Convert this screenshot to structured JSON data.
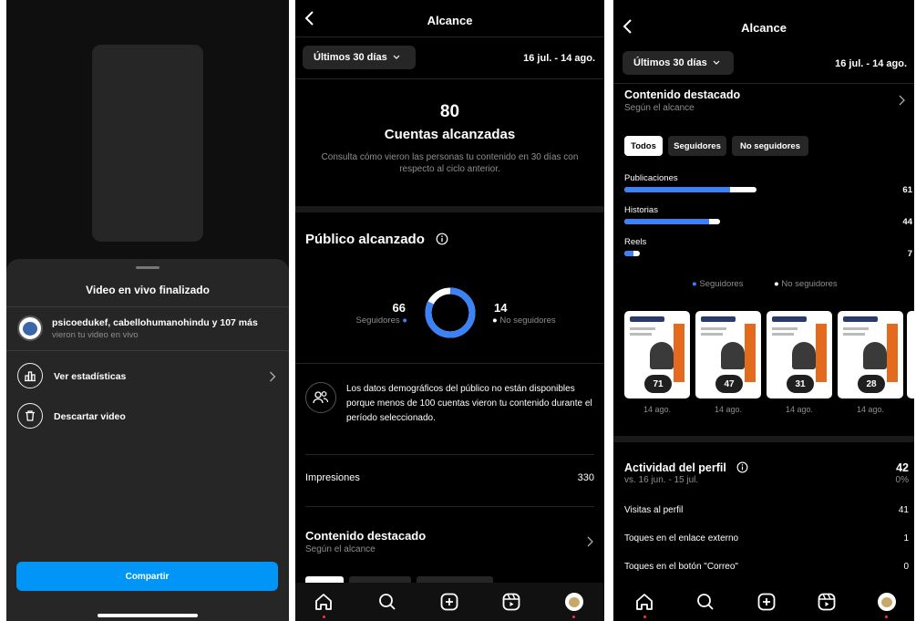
{
  "panel1": {
    "sheet_title": "Video en vivo finalizado",
    "viewers_names": "psicoedukef, cabellohumanohindu y 107 más",
    "viewers_sub": "vieron tu video en vivo",
    "stats_label": "Ver estadísticas",
    "discard_label": "Descartar video",
    "share_label": "Compartir"
  },
  "panel2": {
    "title": "Alcance",
    "range_label": "Últimos 30 días",
    "date_range": "16 jul. - 14 ago.",
    "accounts_count": "80",
    "accounts_label": "Cuentas alcanzadas",
    "accounts_desc": "Consulta cómo vieron las personas tu contenido en 30 días con respecto al ciclo anterior.",
    "audience_title": "Público alcanzado",
    "followers_count": "66",
    "followers_label": "Seguidores",
    "nonfollowers_count": "14",
    "nonfollowers_label": "No seguidores",
    "followers_fraction": 0.825,
    "demo_notice": "Los datos demográficos del público no están disponibles porque menos de 100 cuentas vieron tu contenido durante el período seleccionado.",
    "impressions_label": "Impresiones",
    "impressions_value": "330",
    "featured_title": "Contenido destacado",
    "featured_sub": "Según el alcance"
  },
  "panel3": {
    "title": "Alcance",
    "range_label": "Últimos 30 días",
    "date_range": "16 jul. - 14 ago.",
    "featured_title": "Contenido destacado",
    "featured_sub": "Según el alcance",
    "filters": [
      "Todos",
      "Seguidores",
      "No seguidores"
    ],
    "bars": [
      {
        "label": "Publicaciones",
        "value": "61",
        "followers": 49,
        "total": 61
      },
      {
        "label": "Historias",
        "value": "44",
        "followers": 39,
        "total": 44
      },
      {
        "label": "Reels",
        "value": "7",
        "followers": 4,
        "total": 7
      }
    ],
    "legend_followers": "Seguidores",
    "legend_nonfollowers": "No seguidores",
    "thumb_logo": "RECONEXIÓN",
    "thumbs": [
      {
        "count": "71",
        "date": "14 ago."
      },
      {
        "count": "47",
        "date": "14 ago."
      },
      {
        "count": "31",
        "date": "14 ago."
      },
      {
        "count": "28",
        "date": "14 ago."
      }
    ],
    "activity_title": "Actividad del perfil",
    "activity_sub": "vs. 16 jun. - 15 jul.",
    "activity_value": "42",
    "activity_pct": "0%",
    "rows": [
      {
        "label": "Visitas al perfil",
        "value": "41"
      },
      {
        "label": "Toques en el enlace externo",
        "value": "1"
      },
      {
        "label": "Toques en el botón \"Correo\"",
        "value": "0"
      }
    ]
  },
  "colors": {
    "accent": "#3b82f6",
    "share_blue": "#0095f6",
    "nonfollower": "#ffffff"
  }
}
